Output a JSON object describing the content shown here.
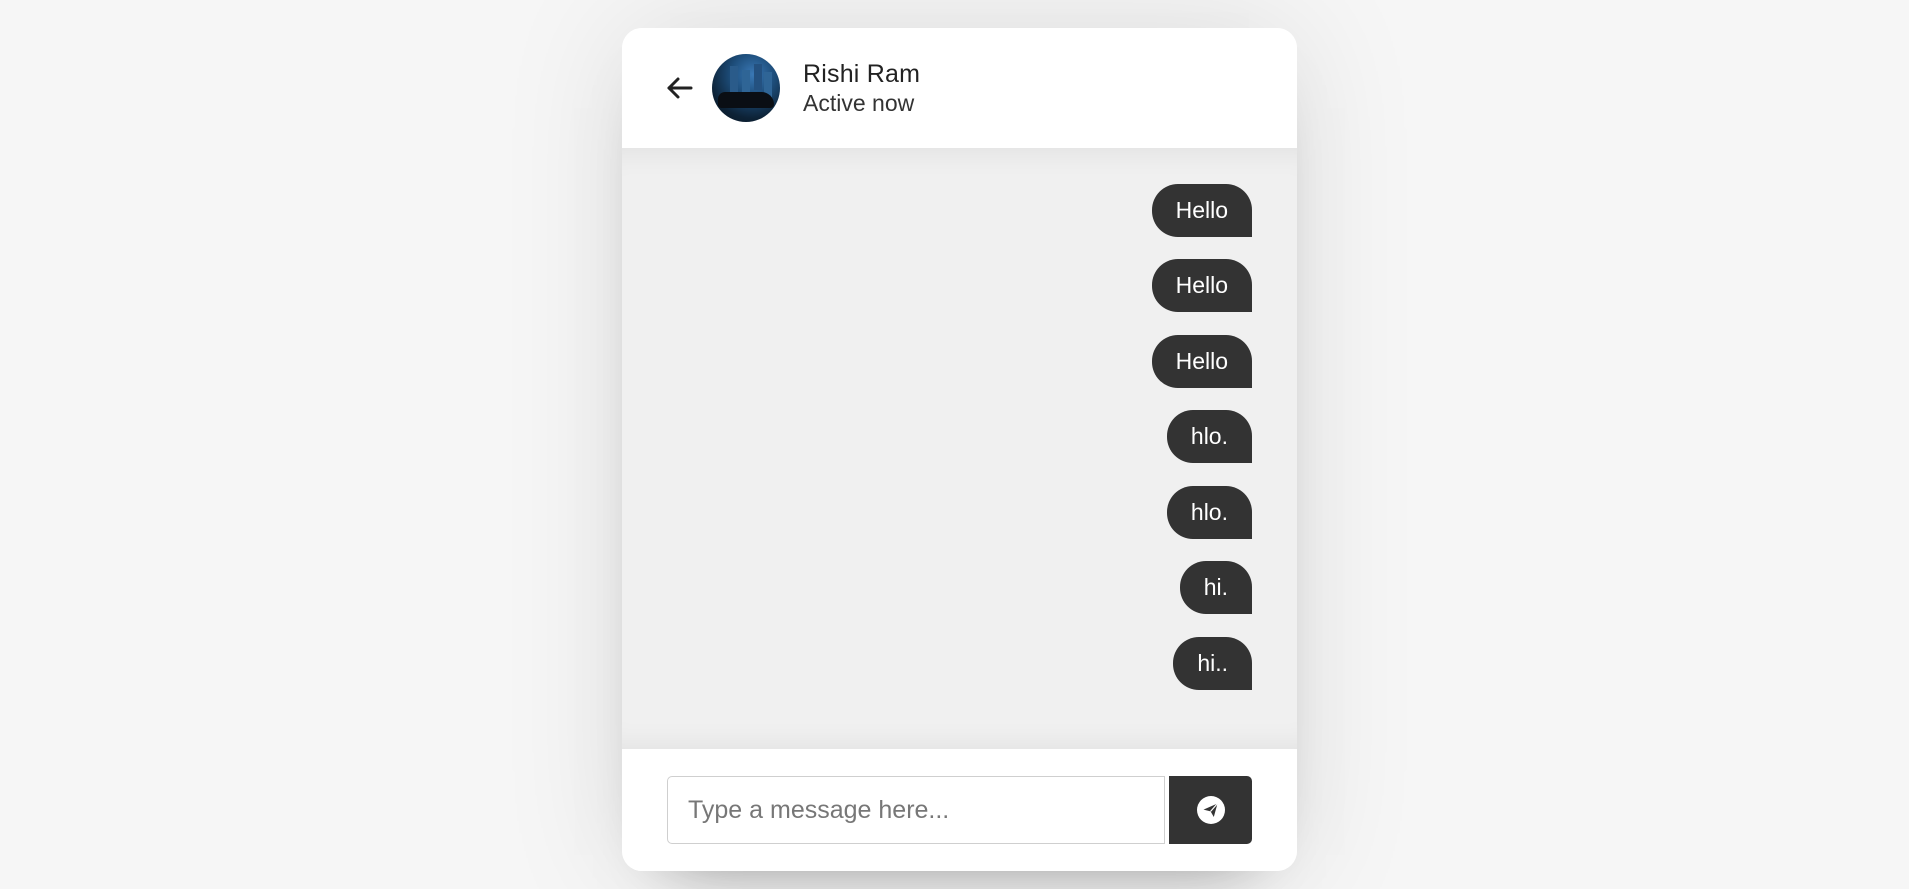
{
  "header": {
    "back_icon": "arrow-left-icon",
    "user_name": "Rishi Ram",
    "status": "Active now"
  },
  "messages": [
    {
      "text": "Hello",
      "direction": "outgoing"
    },
    {
      "text": "Hello",
      "direction": "outgoing"
    },
    {
      "text": "Hello",
      "direction": "outgoing"
    },
    {
      "text": "hlo.",
      "direction": "outgoing"
    },
    {
      "text": "hlo.",
      "direction": "outgoing"
    },
    {
      "text": "hi.",
      "direction": "outgoing"
    },
    {
      "text": "hi..",
      "direction": "outgoing"
    }
  ],
  "composer": {
    "placeholder": "Type a message here...",
    "value": "",
    "send_icon": "paper-plane-icon"
  },
  "colors": {
    "page_bg": "#f6f6f6",
    "bubble_bg": "#333333",
    "bubble_text": "#ffffff",
    "chat_area_bg": "#f0f0f0"
  }
}
